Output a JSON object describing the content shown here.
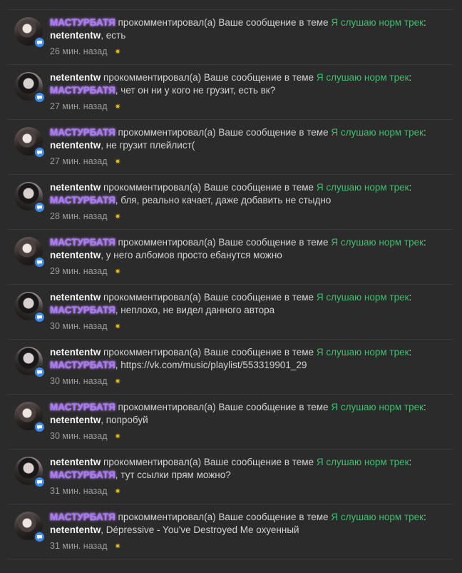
{
  "action_text": "прокомментировал(а) Ваше сообщение в теме",
  "topic": "Я слушаю норм трек",
  "colors": {
    "background": "#2b2b2b",
    "topic_link": "#3fbf6f",
    "glow_nick": "#a87cf0",
    "badge": "#3f8cf0",
    "star": "#e8c21c"
  },
  "notices": [
    {
      "author": "МАСТУРБАТЯ",
      "author_style": "glow",
      "to": "netententw",
      "to_style": "plain",
      "message": "есть",
      "time": "26 мин. назад"
    },
    {
      "author": "netententw",
      "author_style": "plain",
      "to": "МАСТУРБАТЯ",
      "to_style": "glow",
      "message": "чет он ни у кого не грузит, есть вк?",
      "time": "27 мин. назад"
    },
    {
      "author": "МАСТУРБАТЯ",
      "author_style": "glow",
      "to": "netententw",
      "to_style": "plain",
      "message": "не грузит плейлист(",
      "time": "27 мин. назад"
    },
    {
      "author": "netententw",
      "author_style": "plain",
      "to": "МАСТУРБАТЯ",
      "to_style": "glow",
      "message": "бля, реально качает, даже добавить не стыдно",
      "time": "28 мин. назад"
    },
    {
      "author": "МАСТУРБАТЯ",
      "author_style": "glow",
      "to": "netententw",
      "to_style": "plain",
      "message": "у него албомов просто ебанутся можно",
      "time": "29 мин. назад"
    },
    {
      "author": "netententw",
      "author_style": "plain",
      "to": "МАСТУРБАТЯ",
      "to_style": "glow",
      "message": "неплохо, не видел данного автора",
      "time": "30 мин. назад"
    },
    {
      "author": "netententw",
      "author_style": "plain",
      "to": "МАСТУРБАТЯ",
      "to_style": "glow",
      "message": "https://vk.com/music/playlist/553319901_29",
      "time": "30 мин. назад"
    },
    {
      "author": "МАСТУРБАТЯ",
      "author_style": "glow",
      "to": "netententw",
      "to_style": "plain",
      "message": "попробуй",
      "time": "30 мин. назад"
    },
    {
      "author": "netententw",
      "author_style": "plain",
      "to": "МАСТУРБАТЯ",
      "to_style": "glow",
      "message": "тут ссылки прям можно?",
      "time": "31 мин. назад"
    },
    {
      "author": "МАСТУРБАТЯ",
      "author_style": "glow",
      "to": "netententw",
      "to_style": "plain",
      "message": "Dépressive - You've Destroyed Me охуенный",
      "time": "31 мин. назад"
    }
  ]
}
